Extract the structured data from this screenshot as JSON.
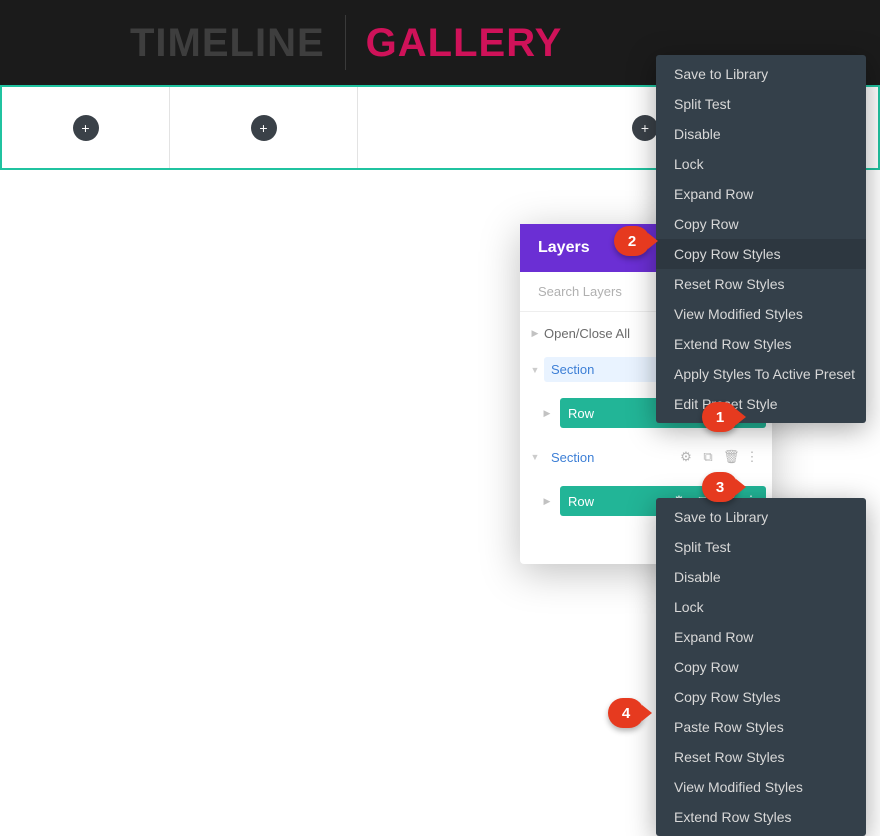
{
  "header": {
    "tab_timeline": "TIMELINE",
    "tab_gallery": "GALLERY"
  },
  "row_add_icon": "+",
  "layers": {
    "title": "Layers",
    "search_placeholder": "Search Layers",
    "openclose": "Open/Close All",
    "section_label": "Section",
    "row_label": "Row",
    "icons": {
      "gear": "gear",
      "duplicate": "duplicate",
      "trash": "trash",
      "more": "more"
    }
  },
  "ctx_top": {
    "items": [
      "Save to Library",
      "Split Test",
      "Disable",
      "Lock",
      "Expand Row",
      "Copy Row",
      "Copy Row Styles",
      "Reset Row Styles",
      "View Modified Styles",
      "Extend Row Styles",
      "Apply Styles To Active Preset",
      "Edit Preset Style"
    ],
    "highlight_index": 6
  },
  "ctx_bottom": {
    "items": [
      "Save to Library",
      "Split Test",
      "Disable",
      "Lock",
      "Expand Row",
      "Copy Row",
      "Copy Row Styles",
      "Paste Row Styles",
      "Reset Row Styles",
      "View Modified Styles",
      "Extend Row Styles"
    ]
  },
  "callouts": {
    "c1": "1",
    "c2": "2",
    "c3": "3",
    "c4": "4"
  }
}
